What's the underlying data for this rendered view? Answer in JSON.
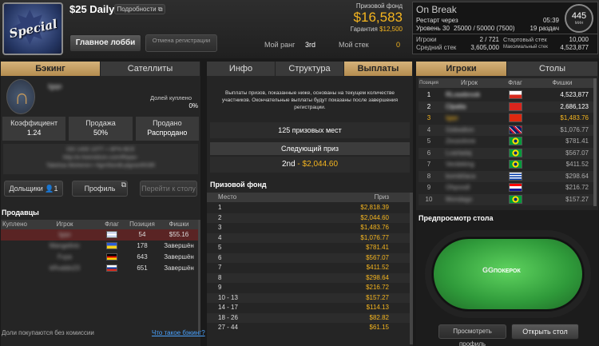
{
  "header": {
    "title": "$25 Daily",
    "details_label": "Подробности",
    "lobby_label": "Главное лобби",
    "cancel_reg_label": "Отмена регистрации",
    "rank_label": "Мой ранг",
    "rank_value": "3rd",
    "stack_label": "Мой стек",
    "stack_value": "0",
    "prize_pool_label": "Призовой фонд",
    "prize_pool_value": "$16,583",
    "guarantee_label": "Гарантия",
    "guarantee_value": "$12,500"
  },
  "status": {
    "title": "On Break",
    "restart_label": "Рестарт через",
    "restart_value": "05:39",
    "level_label": "Уровень 30",
    "level_value": "25000 / 50000 (7500)",
    "hands_value": "19 раздач",
    "players_label": "Игроки",
    "players_value": "2 / 721",
    "start_stack_label": "Стартовый стек",
    "start_stack_value": "10,000",
    "avg_stack_label": "Средний стек",
    "avg_stack_value": "3,605,000",
    "max_stack_label": "Максимальный стек",
    "max_stack_value": "4,523,877",
    "clock_value": "445",
    "clock_unit": "мин"
  },
  "left": {
    "tabs": [
      "Бэкинг",
      "Сателлиты"
    ],
    "user_name": "Igqo",
    "shares_label": "Долей куплено",
    "shares_value": "0%",
    "stats": [
      {
        "label": "Коэффициент",
        "value": "1.24"
      },
      {
        "label": "Продажа",
        "value": "50%"
      },
      {
        "label": "Продано",
        "value": "Распродано"
      }
    ],
    "desc_lines": [
      "ОО 1400 10ТТ + 6Р% ВСЕ",
      "http://e.freerollzon.com/ffhpav-",
      "Tabelsia Mishenin+ Hgm5lsmB.plgrwnR03R"
    ],
    "backers_label": "Дольщики",
    "backers_count": "1",
    "profile_label": "Профиль",
    "goto_table_label": "Перейти к столу",
    "sellers_title": "Продавцы",
    "sellers_cols": [
      "Куплено",
      "Игрок",
      "Флаг",
      "Позиция",
      "Фишки"
    ],
    "sellers": [
      {
        "bought": "",
        "player": "Igqo",
        "position": "54",
        "chips": "$55.16"
      },
      {
        "bought": "",
        "player": "Mangelinic",
        "position": "178",
        "chips": "Завершён"
      },
      {
        "bought": "",
        "player": "Fuya",
        "position": "643",
        "chips": "Завершён"
      },
      {
        "bought": "",
        "player": "kRvaldo23",
        "position": "651",
        "chips": "Завершён"
      }
    ],
    "footer_note": "Доли покупаются без комиссии",
    "footer_link": "Что такое бэкинг?"
  },
  "center": {
    "tabs": [
      "Инфо",
      "Структура",
      "Выплаты"
    ],
    "notice": "Выплаты призов, показанные ниже, основаны на текущем количестве участников. Окончательные выплаты будут показаны после завершения регистрации.",
    "places_text": "125 призовых мест",
    "next_prize_label": "Следующий приз",
    "next_place": "2nd",
    "next_dash": "-",
    "next_amount": "$2,044.60",
    "pool_title": "Призовой фонд",
    "cols": [
      "Место",
      "Приз"
    ],
    "payouts": [
      {
        "place": "1",
        "prize": "$2,818.39"
      },
      {
        "place": "2",
        "prize": "$2,044.60"
      },
      {
        "place": "3",
        "prize": "$1,483.76"
      },
      {
        "place": "4",
        "prize": "$1,076.77"
      },
      {
        "place": "5",
        "prize": "$781.41"
      },
      {
        "place": "6",
        "prize": "$567.07"
      },
      {
        "place": "7",
        "prize": "$411.52"
      },
      {
        "place": "8",
        "prize": "$298.64"
      },
      {
        "place": "9",
        "prize": "$216.72"
      },
      {
        "place": "10 - 13",
        "prize": "$157.27"
      },
      {
        "place": "14 - 17",
        "prize": "$114.13"
      },
      {
        "place": "18 - 26",
        "prize": "$82.82"
      },
      {
        "place": "27 - 44",
        "prize": "$61.15"
      }
    ]
  },
  "right": {
    "tabs": [
      "Игроки",
      "Столы"
    ],
    "cols": [
      "Позиция",
      "Игрок",
      "Флаг",
      "Фишки"
    ],
    "players": [
      {
        "pos": "1",
        "name": "RLosebrook",
        "chips": "4,523,877"
      },
      {
        "pos": "2",
        "name": "Clpatta",
        "chips": "2,686,123"
      },
      {
        "pos": "3",
        "name": "Igqo",
        "chips": "$1,483.76"
      },
      {
        "pos": "4",
        "name": "Gidwalton",
        "chips": "$1,076.77"
      },
      {
        "pos": "5",
        "name": "Zeusolone",
        "chips": "$781.41"
      },
      {
        "pos": "6",
        "name": "Lvarladaj",
        "chips": "$567.07"
      },
      {
        "pos": "7",
        "name": "Verdeking",
        "chips": "$411.52"
      },
      {
        "pos": "8",
        "name": "bomb0aca",
        "chips": "$298.64"
      },
      {
        "pos": "9",
        "name": "Ohpoodl",
        "chips": "$216.72"
      },
      {
        "pos": "10",
        "name": "Mondago",
        "chips": "$157.27"
      }
    ],
    "preview_title": "Предпросмотр стола",
    "table_logo": "ПОКЕРОК",
    "view_profile_label": "Просмотреть профиль",
    "open_table_label": "Открыть стол"
  },
  "colors": {
    "accent": "#f5b51f",
    "tab_active": "#c9a568",
    "felt": "#2f9a3a"
  }
}
